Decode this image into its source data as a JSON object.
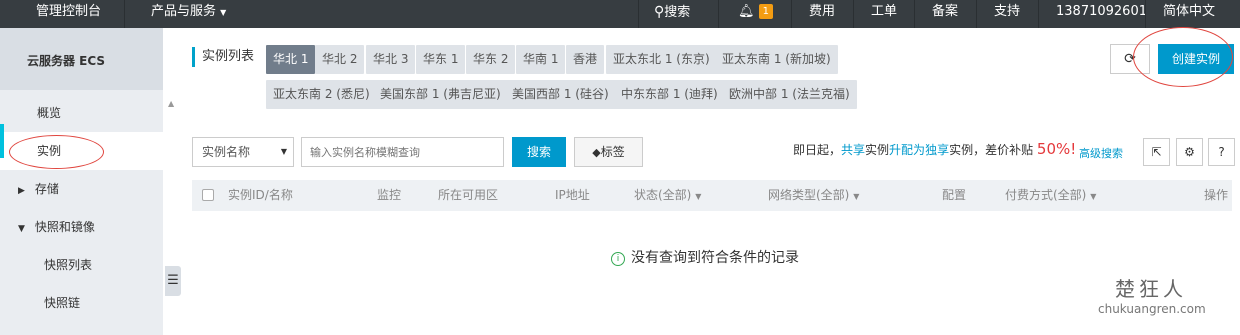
{
  "topbar": {
    "console": "管理控制台",
    "products": "产品与服务",
    "search": "搜索",
    "notifications": "1",
    "billing": "费用",
    "tickets": "工单",
    "icp": "备案",
    "support": "支持",
    "phone": "13871092601",
    "language": "简体中文"
  },
  "sidebar": {
    "title": "云服务器 ECS",
    "items": [
      {
        "label": "概览"
      },
      {
        "label": "实例"
      },
      {
        "label": "存储"
      },
      {
        "label": "快照和镜像"
      },
      {
        "label": "快照列表"
      },
      {
        "label": "快照链"
      }
    ]
  },
  "regions": {
    "label": "实例列表",
    "tabs": [
      "华北 1",
      "华北 2",
      "华北 3",
      "华东 1",
      "华东 2",
      "华南 1",
      "香港",
      "亚太东北 1 (东京)",
      "亚太东南 1 (新加坡)",
      "亚太东南 2 (悉尼)",
      "美国东部 1 (弗吉尼亚)",
      "美国西部 1 (硅谷)",
      "中东东部 1 (迪拜)",
      "欧洲中部 1 (法兰克福)"
    ]
  },
  "actions": {
    "create": "创建实例"
  },
  "filter": {
    "select_value": "实例名称",
    "input_placeholder": "输入实例名称模糊查询",
    "search_btn": "搜索",
    "tags_btn": "标签",
    "promo_prefix": "即日起，",
    "promo_shared": "共享",
    "promo_mid1": "实例",
    "promo_upgrade": "升配为",
    "promo_exclusive": "独享",
    "promo_mid2": "实例，差价补贴 ",
    "promo_percent": "50%!",
    "advanced": "高级搜索"
  },
  "table": {
    "columns": [
      "实例ID/名称",
      "监控",
      "所在可用区",
      "IP地址",
      "状态(全部)",
      "网络类型(全部)",
      "配置",
      "付费方式(全部)",
      "操作"
    ],
    "empty_text": "没有查询到符合条件的记录"
  },
  "watermark": {
    "cn": "楚狂人",
    "en": "chukuangren.com"
  },
  "colors": {
    "topbar": "#373d41",
    "primary": "#0099cc",
    "active_tab": "#717d8b",
    "annotation": "#e0463f"
  }
}
